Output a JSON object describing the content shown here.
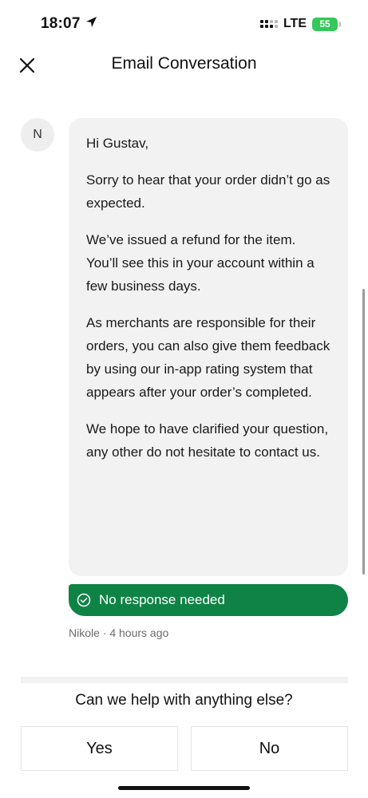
{
  "status_bar": {
    "time": "18:07",
    "network": "LTE",
    "battery_level": "55",
    "battery_color": "#34c759"
  },
  "header": {
    "title": "Email Conversation",
    "close_icon": "close-icon"
  },
  "message": {
    "avatar_initial": "N",
    "paragraphs": [
      "Hi Gustav,",
      "Sorry to hear that your order didn’t go as expected.",
      "We’ve issued a refund for the item. You’ll see this in your account within a few business days.",
      "As merchants are responsible for their orders, you can also give them feedback by using our in-app rating system that appears after your order’s completed.",
      "We hope to have clarified your question, any other do not hesitate to contact us."
    ],
    "status_label": "No response needed",
    "status_color": "#0e8345",
    "meta": "Nikole · 4 hours ago"
  },
  "footer": {
    "question": "Can we help with anything else?",
    "yes_label": "Yes",
    "no_label": "No"
  }
}
